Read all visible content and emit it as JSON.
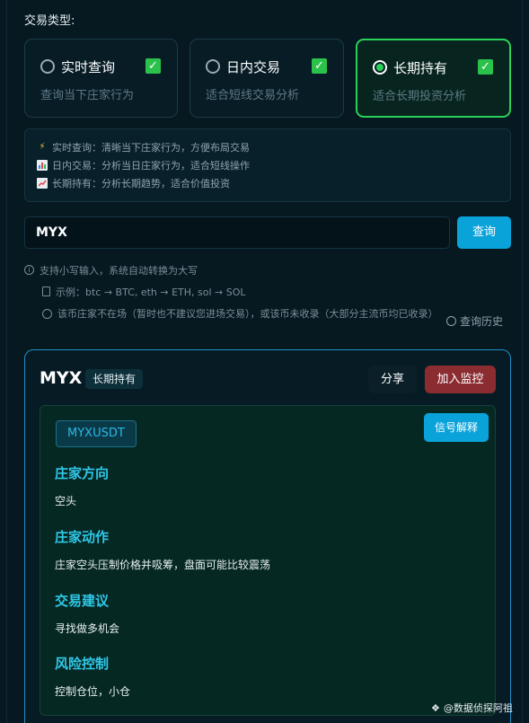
{
  "trade_type": {
    "label": "交易类型:",
    "options": [
      {
        "title": "实时查询",
        "desc": "查询当下庄家行为",
        "selected": false,
        "checked": true
      },
      {
        "title": "日内交易",
        "desc": "适合短线交易分析",
        "selected": false,
        "checked": true
      },
      {
        "title": "长期持有",
        "desc": "适合长期投资分析",
        "selected": true,
        "checked": true
      }
    ]
  },
  "tips": [
    {
      "icon": "lightning-icon",
      "text": "实时查询：清晰当下庄家行为，方便布局交易"
    },
    {
      "icon": "bar-chart-icon",
      "text": "日内交易：分析当日庄家行为，适合短线操作"
    },
    {
      "icon": "trend-chart-icon",
      "text": "长期持有：分析长期趋势，适合价值投资"
    }
  ],
  "search": {
    "value": "MYX",
    "button": "查询"
  },
  "hints": {
    "case": "支持小写输入，系统自动转换为大写",
    "example": "示例：btc → BTC, eth → ETH, sol → SOL",
    "notice": "该币庄家不在场（暂时也不建议您进场交易），或该币未收录（大部分主流币均已收录）",
    "history": "查询历史"
  },
  "result": {
    "symbol": "MYX",
    "tag": "长期持有",
    "share": "分享",
    "monitor": "加入监控",
    "pair": "MYXUSDT",
    "signal_button": "信号解释",
    "sections": [
      {
        "title": "庄家方向",
        "text": "空头"
      },
      {
        "title": "庄家动作",
        "text": "庄家空头压制价格并吸筹，盘面可能比较震荡"
      },
      {
        "title": "交易建议",
        "text": "寻找做多机会"
      },
      {
        "title": "风险控制",
        "text": "控制仓位，小仓"
      }
    ]
  },
  "watermark": "@数据侦探阿祖",
  "colors": {
    "accent": "#0aa3d9",
    "selected_border": "#2bd05a",
    "section_title": "#2fc8e8",
    "monitor_button": "#8b2c31"
  }
}
